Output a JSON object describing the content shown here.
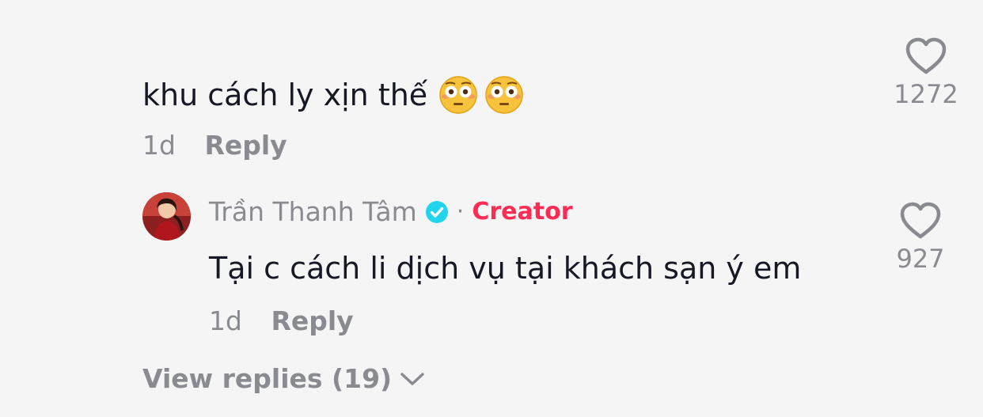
{
  "comment": {
    "text": "khu cách ly xịn thế",
    "emojis": [
      "flushed-face-emoji",
      "flushed-face-emoji"
    ],
    "time": "1d",
    "reply_label": "Reply",
    "like_count": "1272"
  },
  "reply": {
    "author": "Trần Thanh Tâm",
    "separator": "·",
    "badge": "Creator",
    "text": "Tại c cách li dịch vụ tại khách sạn ý em",
    "time": "1d",
    "reply_label": "Reply",
    "like_count": "927"
  },
  "view_replies": {
    "label": "View replies (19)"
  },
  "colors": {
    "background": "#f5f5f5",
    "text": "#161823",
    "muted": "#8a8b91",
    "creator": "#fe2c55",
    "verified": "#20d5ec"
  }
}
